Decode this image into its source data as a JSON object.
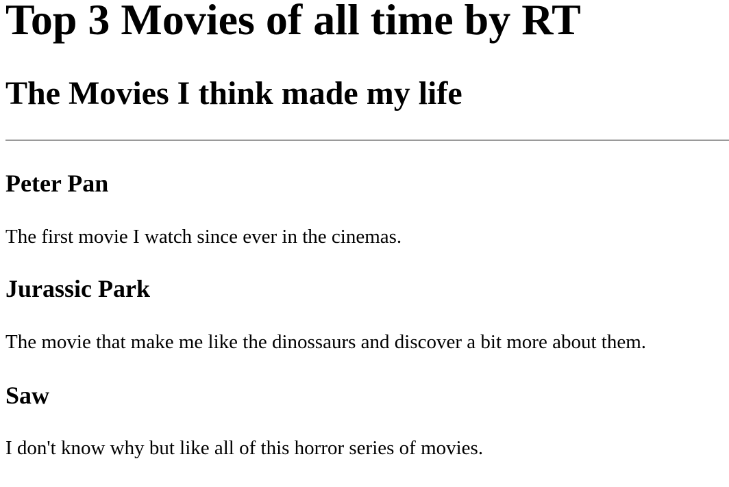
{
  "page": {
    "title": "Top 3 Movies of all time by RT",
    "subtitle": "The Movies I think made my life"
  },
  "movies": [
    {
      "title": "Peter Pan",
      "description": "The first movie I watch since ever in the cinemas."
    },
    {
      "title": "Jurassic Park",
      "description": "The movie that make me like the dinossaurs and discover a bit more about them."
    },
    {
      "title": "Saw",
      "description": "I don't know why but like all of this horror series of movies."
    }
  ]
}
